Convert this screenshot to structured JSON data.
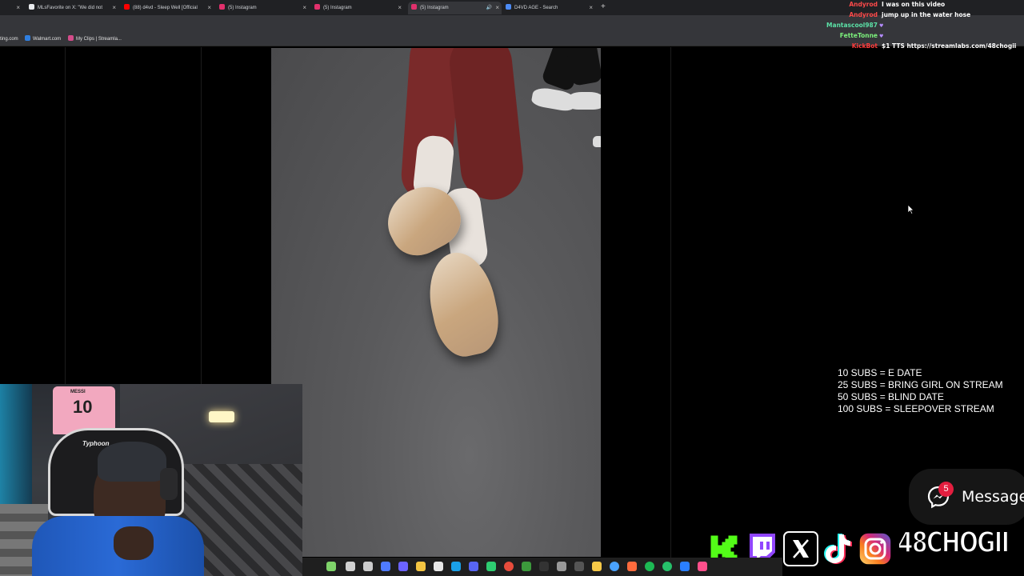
{
  "browser": {
    "tabs": [
      {
        "title": "",
        "favicon_color": "#9aa0a6",
        "active": false
      },
      {
        "title": "MLsFavorite on X: \"We did not",
        "favicon_color": "#e8eaed",
        "active": false
      },
      {
        "title": "(88) d4vd - Sleep Well [Official",
        "favicon_color": "#ff0000",
        "active": false
      },
      {
        "title": "(5) Instagram",
        "favicon_color": "#e1306c",
        "active": false
      },
      {
        "title": "(5) Instagram",
        "favicon_color": "#e1306c",
        "active": false
      },
      {
        "title": "(5) Instagram",
        "favicon_color": "#e1306c",
        "active": true
      },
      {
        "title": "D4VD AGE - Search",
        "favicon_color": "#4c8bf5",
        "active": false
      }
    ],
    "new_tab_label": "+",
    "close_glyph": "×",
    "bookmarks": [
      {
        "label": "ting.com",
        "icon_color": ""
      },
      {
        "label": "Walmart.com",
        "icon_color": "#2f7fe0"
      },
      {
        "label": "My Clips | Streamla...",
        "icon_color": "#d44c8a"
      }
    ]
  },
  "chat": {
    "messages": [
      {
        "user": "Andyrod",
        "user_color": "#ff4a4a",
        "badge": "",
        "text": "I was on this video"
      },
      {
        "user": "Andyrod",
        "user_color": "#ff4a4a",
        "badge": "",
        "text": "jump up in the water hose"
      },
      {
        "user": "Mantascool987",
        "user_color": "#5be0a6",
        "badge": "♥",
        "text": ""
      },
      {
        "user": "FetteTonne",
        "user_color": "#7cf07c",
        "badge": "♥",
        "text": ""
      },
      {
        "user": "KickBot",
        "user_color": "#ff3c3c",
        "badge": "",
        "text": "$1 TTS https://streamlabs.com/48chogii"
      }
    ]
  },
  "sub_goals": [
    "10 SUBS = E DATE",
    "25 SUBS = BRING GIRL ON STREAM",
    "50 SUBS = BLIND DATE",
    "100 SUBS = SLEEPOVER STREAM"
  ],
  "message_button": {
    "label": "Message",
    "unread_count": "5",
    "icon": "messenger-icon"
  },
  "social": {
    "icons": [
      {
        "name": "kick-icon",
        "letter": "K",
        "color": "#53fc18"
      },
      {
        "name": "twitch-icon",
        "letter": "",
        "color": "#9146ff"
      },
      {
        "name": "x-icon",
        "letter": "X",
        "color": "#000000"
      },
      {
        "name": "tiktok-icon",
        "letter": "",
        "color": "#000000"
      },
      {
        "name": "instagram-icon",
        "letter": "",
        "color": "#e1306c"
      }
    ],
    "handle": "48CHOGII"
  },
  "webcam": {
    "jersey_name": "MESSI",
    "jersey_number": "10",
    "chair_brand": "Typhoon"
  }
}
